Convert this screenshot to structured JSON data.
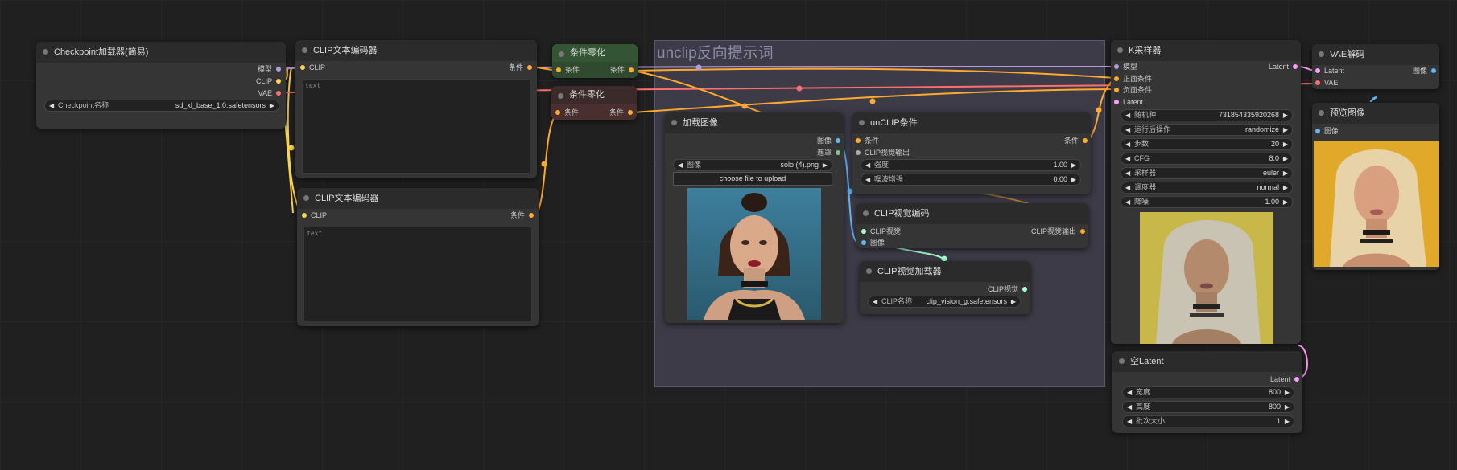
{
  "colors": {
    "model": "#b39ddb",
    "clip": "#ffd54f",
    "vae": "#ff6e6e",
    "cond": "#ffa931",
    "latent": "#ff9cf9",
    "image": "#64b5f6",
    "mask": "#81c784",
    "clipvision": "#a1ffd0"
  },
  "group": {
    "title": "unclip反向提示词"
  },
  "ckpt": {
    "title": "Checkpoint加载器(简易)",
    "out_model": "模型",
    "out_clip": "CLIP",
    "out_vae": "VAE",
    "w_label": "Checkpoint名称",
    "w_value": "sd_xl_base_1.0.safetensors"
  },
  "clip1": {
    "title": "CLIP文本编码器",
    "in_clip": "CLIP",
    "out_cond": "条件",
    "text": "text"
  },
  "clip2": {
    "title": "CLIP文本编码器",
    "in_clip": "CLIP",
    "out_cond": "条件",
    "text": "text"
  },
  "zero1": {
    "title": "条件零化",
    "in": "条件",
    "out": "条件"
  },
  "zero2": {
    "title": "条件零化",
    "in": "条件",
    "out": "条件"
  },
  "loadimg": {
    "title": "加载图像",
    "out_image": "图像",
    "out_mask": "遮罩",
    "w_label": "图像",
    "w_value": "solo (4).png",
    "upload": "choose file to upload"
  },
  "unclip": {
    "title": "unCLIP条件",
    "in_cond": "条件",
    "in_cv": "CLIP视觉输出",
    "out_cond": "条件",
    "w1_label": "强度",
    "w1_value": "1.00",
    "w2_label": "噪波增强",
    "w2_value": "0.00"
  },
  "cvenc": {
    "title": "CLIP视觉编码",
    "in_cv": "CLIP视觉",
    "in_image": "图像",
    "out": "CLIP视觉输出"
  },
  "cvload": {
    "title": "CLIP视觉加载器",
    "out": "CLIP视觉",
    "w_label": "CLIP名称",
    "w_value": "clip_vision_g.safetensors"
  },
  "ksampler": {
    "title": "K采样器",
    "in_model": "模型",
    "in_pos": "正面条件",
    "in_neg": "负面条件",
    "in_latent": "Latent",
    "out_latent": "Latent",
    "widgets": [
      {
        "label": "随机种",
        "value": "731854335920268"
      },
      {
        "label": "运行后操作",
        "value": "randomize"
      },
      {
        "label": "步数",
        "value": "20"
      },
      {
        "label": "CFG",
        "value": "8.0"
      },
      {
        "label": "采样器",
        "value": "euler"
      },
      {
        "label": "调度器",
        "value": "normal"
      },
      {
        "label": "降噪",
        "value": "1.00"
      }
    ]
  },
  "emptylatent": {
    "title": "空Latent",
    "out": "Latent",
    "widgets": [
      {
        "label": "宽度",
        "value": "800"
      },
      {
        "label": "高度",
        "value": "800"
      },
      {
        "label": "批次大小",
        "value": "1"
      }
    ]
  },
  "vaedecode": {
    "title": "VAE解码",
    "in_latent": "Latent",
    "in_vae": "VAE",
    "out_image": "图像"
  },
  "preview": {
    "title": "预览图像",
    "in_image": "图像"
  }
}
